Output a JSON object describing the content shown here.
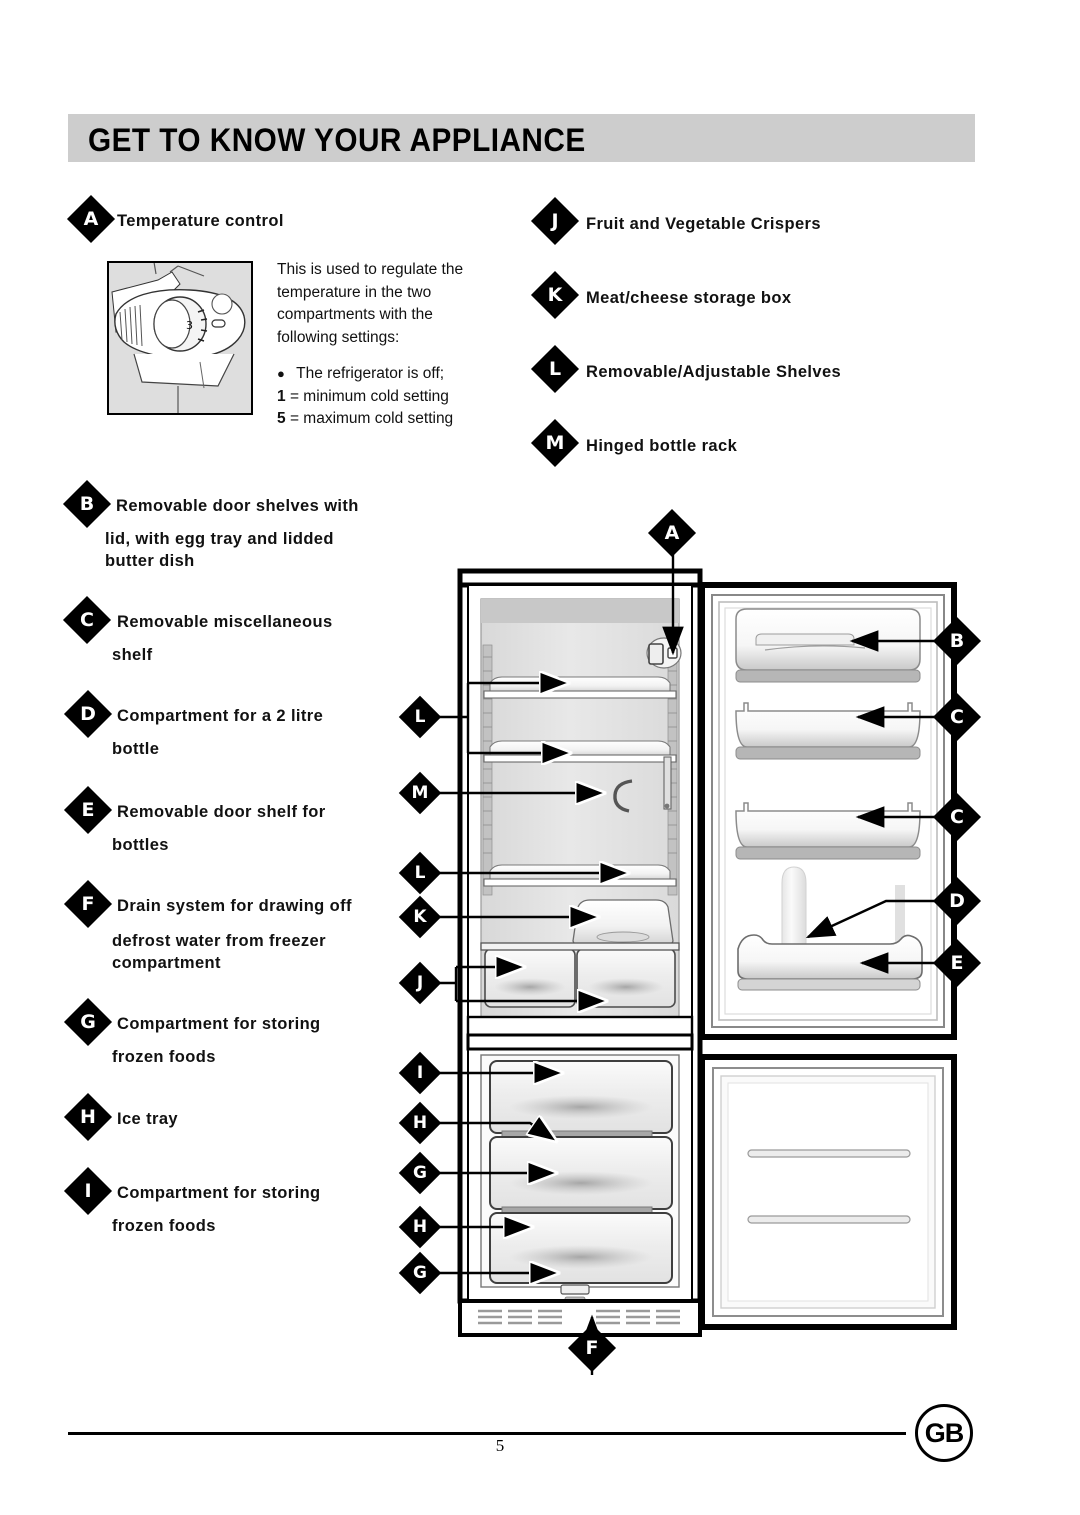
{
  "header": {
    "title": "GET TO KNOW YOUR APPLIANCE"
  },
  "thermostat": {
    "icon": "thermostat-dial-illustration",
    "dial_number": "3"
  },
  "intro": {
    "line1": "This is used to regulate the",
    "line2": "temperature in the two",
    "line3": "compartments with the",
    "line4": "following settings:",
    "setting_off_bullet": "●",
    "setting_off": "The refrigerator is off;",
    "setting_min_key": "1",
    "setting_min": "= minimum cold setting",
    "setting_max_key": "5",
    "setting_max": "= maximum cold setting"
  },
  "legend_left": [
    {
      "key": "A",
      "label": "Temperature control"
    },
    {
      "key": "B",
      "label": "Removable door shelves with",
      "label2": "lid, with egg tray and lidded",
      "label3": "butter dish"
    },
    {
      "key": "C",
      "label": "Removable miscellaneous",
      "label2": "shelf"
    },
    {
      "key": "D",
      "label": "Compartment for a 2 litre",
      "label2": "bottle"
    },
    {
      "key": "E",
      "label": "Removable door shelf for",
      "label2": "bottles"
    },
    {
      "key": "F",
      "label": "Drain system for drawing off",
      "label2": "defrost water from freezer",
      "label3": "compartment"
    },
    {
      "key": "G",
      "label": "Compartment for storing",
      "label2": "frozen foods"
    },
    {
      "key": "H",
      "label": "Ice tray"
    },
    {
      "key": "I",
      "label": "Compartment for storing",
      "label2": "frozen foods"
    }
  ],
  "legend_right": [
    {
      "key": "J",
      "label": "Fruit and Vegetable Crispers"
    },
    {
      "key": "K",
      "label": "Meat/cheese storage box"
    },
    {
      "key": "L",
      "label": "Removable/Adjustable Shelves"
    },
    {
      "key": "M",
      "label": "Hinged bottle rack"
    }
  ],
  "diagram_callouts": {
    "top": "A",
    "left": [
      "L",
      "M",
      "L",
      "K",
      "J",
      "I",
      "H",
      "G",
      "H",
      "G"
    ],
    "right": [
      "B",
      "C",
      "C",
      "D",
      "E"
    ],
    "bottom": "F"
  },
  "footer": {
    "page_number": "5",
    "region_badge": "GB",
    "rule": "footer-rule"
  },
  "colors": {
    "header_band": "#cdcdcd",
    "ink": "#000000",
    "panel_fill": "#e3e3e3",
    "page": "#ffffff"
  }
}
